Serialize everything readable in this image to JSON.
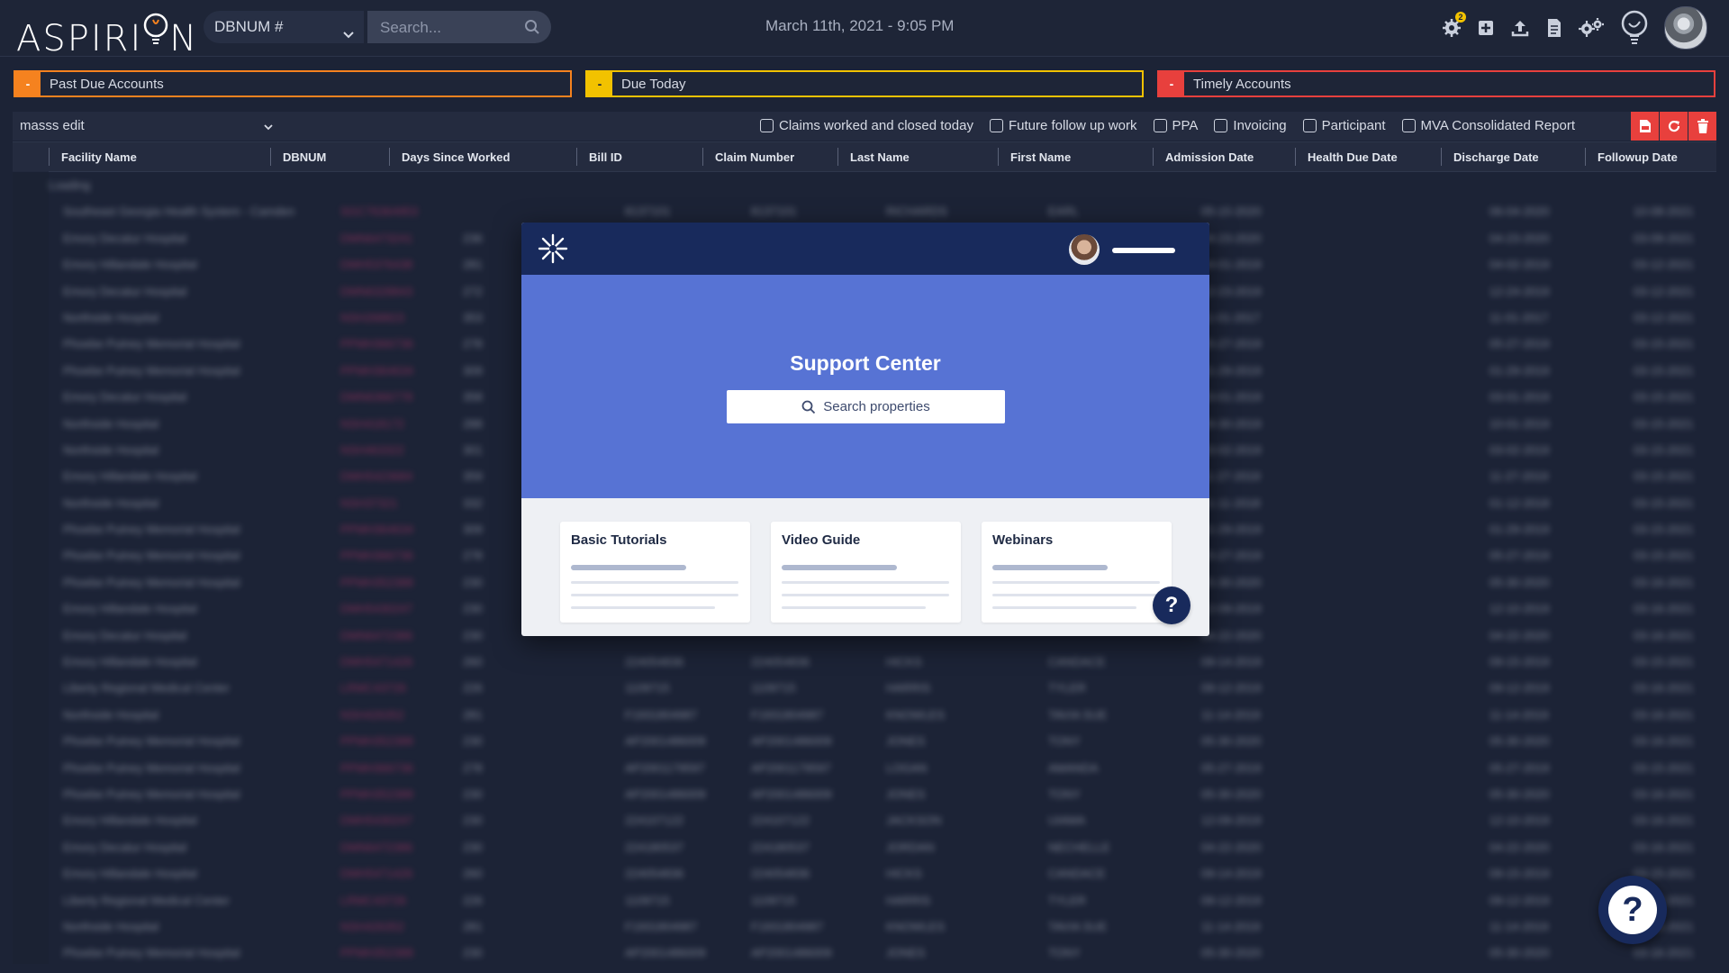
{
  "app": {
    "logo_text": "ASPIRI",
    "logo_text_end": "N"
  },
  "header": {
    "db_select_value": "DBNUM #",
    "search_placeholder": "Search...",
    "datetime": "March 11th, 2021 - 9:05 PM",
    "notification_badge": "2",
    "icons": [
      "alert-gear-icon",
      "add-box-icon",
      "upload-icon",
      "document-icon",
      "settings-icon",
      "idea-bulb-icon"
    ]
  },
  "buckets": [
    {
      "toggle": "-",
      "label": "Past Due Accounts",
      "color": "#f5821f"
    },
    {
      "toggle": "-",
      "label": "Due Today",
      "color": "#f2c200"
    },
    {
      "toggle": "-",
      "label": "Timely Accounts",
      "color": "#e8403d"
    }
  ],
  "filters": {
    "mass_edit": "masss edit",
    "checkboxes": [
      "Claims worked and closed today",
      "Future follow up work",
      "PPA",
      "Invoicing",
      "Participant",
      "MVA Consolidated Report"
    ]
  },
  "grid": {
    "columns": [
      "Facility Name",
      "DBNUM",
      "Days Since Worked",
      "Bill ID",
      "Claim Number",
      "Last Name",
      "First Name",
      "Admission Date",
      "Health Due Date",
      "Discharge Date",
      "Followup Date"
    ],
    "loading_text": "Loading",
    "rows": [
      [
        "Southeast Georgia Health System - Camden",
        "SGC76364953",
        "",
        "8137101",
        "8137101",
        "RICHARDS",
        "EARL",
        "05-15-2020",
        "",
        "06-04-2020",
        "10-08-2021"
      ],
      [
        "Emory Decatur Hospital",
        "DMN6473241",
        "236",
        "",
        "",
        "",
        "",
        "04-23-2020",
        "",
        "04-23-2020",
        "03-09-2021"
      ],
      [
        "Emory Hillandale Hospital",
        "DMH5376438",
        "281",
        "",
        "",
        "",
        "",
        "04-01-2019",
        "",
        "04-02-2019",
        "03-12-2021"
      ],
      [
        "Emory Decatur Hospital",
        "DMN6328843",
        "272",
        "",
        "",
        "",
        "",
        "12-23-2019",
        "",
        "12-24-2019",
        "03-12-2021"
      ],
      [
        "Northside Hospital",
        "NSH268823",
        "353",
        "",
        "",
        "",
        "",
        "11-01-2017",
        "",
        "11-01-2017",
        "03-12-2021"
      ],
      [
        "Phoebe Putney Memorial Hospital",
        "PPMH366736",
        "278",
        "",
        "",
        "",
        "",
        "05-27-2019",
        "",
        "05-27-2019",
        "03-15-2021"
      ],
      [
        "Phoebe Putney Memorial Hospital",
        "PPMH364634",
        "309",
        "",
        "",
        "",
        "",
        "01-29-2019",
        "",
        "01-29-2019",
        "03-15-2021"
      ],
      [
        "Emory Decatur Hospital",
        "DMN6366778",
        "358",
        "",
        "",
        "",
        "",
        "03-01-2019",
        "",
        "03-01-2019",
        "03-15-2021"
      ],
      [
        "Northside Hospital",
        "NSH418172",
        "288",
        "",
        "",
        "",
        "",
        "09-30-2019",
        "",
        "10-01-2019",
        "03-15-2021"
      ],
      [
        "Northside Hospital",
        "NSH463322",
        "301",
        "",
        "",
        "",
        "",
        "03-02-2019",
        "",
        "03-02-2019",
        "03-15-2021"
      ],
      [
        "Emory Hillandale Hospital",
        "DMH5423684",
        "359",
        "",
        "",
        "",
        "",
        "11-27-2019",
        "",
        "11-27-2019",
        "03-15-2021"
      ],
      [
        "Northside Hospital",
        "NSH37321",
        "332",
        "",
        "",
        "",
        "",
        "01-11-2018",
        "",
        "01-12-2018",
        "03-15-2021"
      ],
      [
        "Phoebe Putney Memorial Hospital",
        "PPMH364634",
        "309",
        "",
        "",
        "",
        "",
        "01-29-2019",
        "",
        "01-29-2019",
        "03-15-2021"
      ],
      [
        "Phoebe Putney Memorial Hospital",
        "PPMH366736",
        "278",
        "",
        "",
        "",
        "",
        "05-27-2019",
        "",
        "05-27-2019",
        "03-15-2021"
      ],
      [
        "Phoebe Putney Memorial Hospital",
        "PPMH352388",
        "230",
        "",
        "",
        "",
        "",
        "05-30-2020",
        "",
        "05-30-2020",
        "03-16-2021"
      ],
      [
        "Emory Hillandale Hospital",
        "DMH5430247",
        "230",
        "",
        "",
        "",
        "",
        "12-09-2019",
        "",
        "12-10-2019",
        "03-16-2021"
      ],
      [
        "Emory Decatur Hospital",
        "DMN6472386",
        "230",
        "",
        "",
        "",
        "",
        "04-22-2020",
        "",
        "04-22-2020",
        "03-16-2021"
      ],
      [
        "Emory Hillandale Hospital",
        "DMH5471426",
        "260",
        "224054836",
        "224054836",
        "HICKS",
        "CANDACE",
        "09-14-2019",
        "",
        "09-15-2019",
        "03-15-2021"
      ],
      [
        "Liberty Regional Medical Center",
        "LRMC43726",
        "226",
        "1109715",
        "1109715",
        "HARRIS",
        "TYLER",
        "09-12-2019",
        "",
        "09-12-2019",
        "03-16-2021"
      ],
      [
        "Northside Hospital",
        "NSH426352",
        "281",
        "F1931804987",
        "F1931804987",
        "KNOWLES",
        "TAVIA SUE",
        "11-14-2019",
        "",
        "11-14-2019",
        "03-16-2021"
      ],
      [
        "Phoebe Putney Memorial Hospital",
        "PPMH352388",
        "230",
        "AP2001486009",
        "AP2001486009",
        "JONES",
        "TONY",
        "05-30-2020",
        "",
        "05-30-2020",
        "03-16-2021"
      ],
      [
        "Phoebe Putney Memorial Hospital",
        "PPMH366736",
        "278",
        "AP2001179597",
        "AP2001179597",
        "LOGAN",
        "AMANDA",
        "05-27-2019",
        "",
        "05-27-2019",
        "03-15-2021"
      ],
      [
        "Phoebe Putney Memorial Hospital",
        "PPMH352388",
        "230",
        "AP2001486009",
        "AP2001486009",
        "JONES",
        "TONY",
        "05-30-2020",
        "",
        "05-30-2020",
        "03-16-2021"
      ],
      [
        "Emory Hillandale Hospital",
        "DMH5430247",
        "230",
        "224107122",
        "224107122",
        "JACKSON",
        "UIAMA",
        "12-09-2019",
        "",
        "12-10-2019",
        "03-16-2021"
      ],
      [
        "Emory Decatur Hospital",
        "DMN6472386",
        "230",
        "224180537",
        "224180537",
        "JORDAN",
        "NECHELLE",
        "04-22-2020",
        "",
        "04-22-2020",
        "03-16-2021"
      ],
      [
        "Emory Hillandale Hospital",
        "DMH5471426",
        "260",
        "224054836",
        "224054836",
        "HICKS",
        "CANDACE",
        "09-14-2019",
        "",
        "09-15-2019",
        "03-15-2021"
      ],
      [
        "Liberty Regional Medical Center",
        "LRMC43726",
        "226",
        "1109715",
        "1109715",
        "HARRIS",
        "TYLER",
        "09-12-2019",
        "",
        "09-12-2019",
        "03-16-2021"
      ],
      [
        "Northside Hospital",
        "NSH426352",
        "281",
        "F1931804987",
        "F1931804987",
        "KNOWLES",
        "TAVIA SUE",
        "11-14-2019",
        "",
        "11-14-2019",
        "03-16-2021"
      ],
      [
        "Phoebe Putney Memorial Hospital",
        "PPMH352388",
        "230",
        "AP2001486009",
        "AP2001486009",
        "JONES",
        "TONY",
        "05-30-2020",
        "",
        "05-30-2020",
        "03-16-2021"
      ]
    ]
  },
  "modal": {
    "title": "Support Center",
    "search_label": "Search properties",
    "cards": [
      "Basic Tutorials",
      "Video Guide",
      "Webinars"
    ],
    "help_glyph": "?"
  },
  "fab": {
    "help_glyph": "?"
  },
  "colors": {
    "accent_red": "#e8403d",
    "navy": "#182a5c",
    "hero_blue": "#5773d4",
    "link_pink": "#d13670"
  }
}
